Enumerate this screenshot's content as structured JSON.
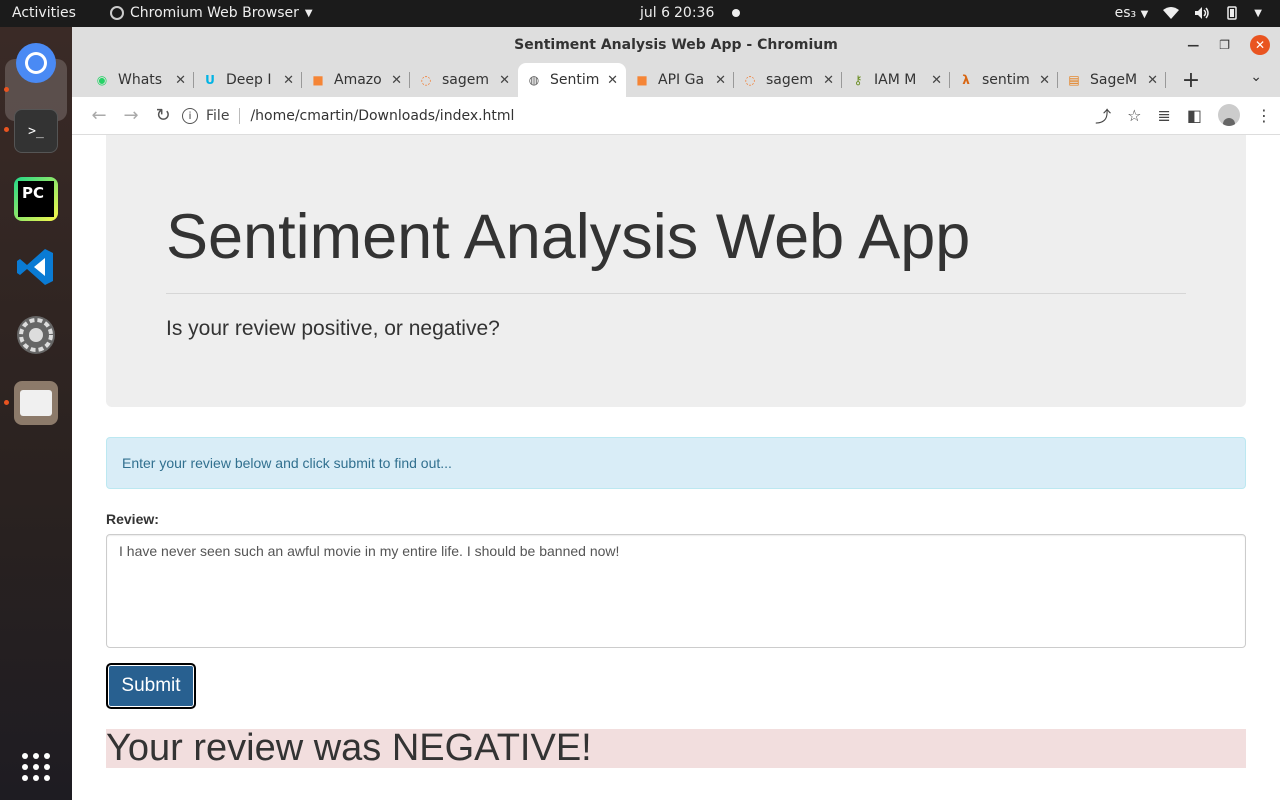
{
  "topbar": {
    "activities": "Activities",
    "app_name": "Chromium Web Browser",
    "date": "jul 6",
    "time": "20:36",
    "keyboard_layout": "es₃"
  },
  "dock": {
    "items": [
      "chromium-icon",
      "terminal-icon",
      "pycharm-icon",
      "vscode-icon",
      "settings-icon",
      "files-icon",
      "show-apps-icon"
    ],
    "terminal_glyph": ">_",
    "pycharm_glyph": "PC"
  },
  "window": {
    "title": "Sentiment Analysis Web App - Chromium"
  },
  "tabs": [
    {
      "title": "Whats",
      "icon": "whatsapp-icon",
      "color": "#25d366"
    },
    {
      "title": "Deep I",
      "icon": "udacity-icon",
      "color": "#02b3e4"
    },
    {
      "title": "Amazo",
      "icon": "aws-box-icon",
      "color": "#f58536"
    },
    {
      "title": "sagem",
      "icon": "jupyter-icon",
      "color": "#f37626"
    },
    {
      "title": "Sentim",
      "icon": "globe-icon",
      "color": "#555555",
      "active": true
    },
    {
      "title": "API Ga",
      "icon": "aws-box-icon",
      "color": "#f58536"
    },
    {
      "title": "sagem",
      "icon": "jupyter-icon",
      "color": "#f37626"
    },
    {
      "title": "IAM M",
      "icon": "iam-key-icon",
      "color": "#6b8e23"
    },
    {
      "title": "sentim",
      "icon": "lambda-icon",
      "color": "#d86613"
    },
    {
      "title": "SageM",
      "icon": "sagemaker-book-icon",
      "color": "#e47911"
    }
  ],
  "address_bar": {
    "scheme_label": "File",
    "url": "/home/cmartin/Downloads/index.html"
  },
  "page": {
    "heading": "Sentiment Analysis Web App",
    "subheading": "Is your review positive, or negative?",
    "info_text": "Enter your review below and click submit to find out...",
    "review_label": "Review:",
    "review_value": "I have never seen such an awful movie in my entire life. I should be banned now!",
    "submit_label": "Submit",
    "result_text": "Your review was NEGATIVE!"
  },
  "colors": {
    "accent_ubuntu": "#e95420",
    "submit_bg": "#286090",
    "result_bg": "#f2dede",
    "info_bg": "#d9edf7"
  }
}
